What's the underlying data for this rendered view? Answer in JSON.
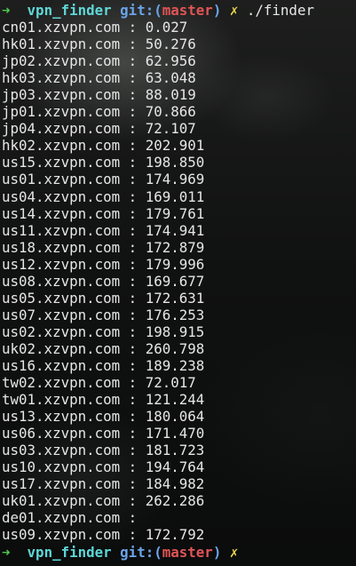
{
  "prompt": {
    "arrow": "➜",
    "cwd": "vpn_finder",
    "git_prefix": "git:(",
    "branch": "master",
    "git_suffix": ")",
    "dirty_mark": "✗"
  },
  "command": "./finder",
  "output": [
    {
      "host": "cn01.xzvpn.com",
      "latency": "0.027"
    },
    {
      "host": "hk01.xzvpn.com",
      "latency": "50.276"
    },
    {
      "host": "jp02.xzvpn.com",
      "latency": "62.956"
    },
    {
      "host": "hk03.xzvpn.com",
      "latency": "63.048"
    },
    {
      "host": "jp03.xzvpn.com",
      "latency": "88.019"
    },
    {
      "host": "jp01.xzvpn.com",
      "latency": "70.866"
    },
    {
      "host": "jp04.xzvpn.com",
      "latency": "72.107"
    },
    {
      "host": "hk02.xzvpn.com",
      "latency": "202.901"
    },
    {
      "host": "us15.xzvpn.com",
      "latency": "198.850"
    },
    {
      "host": "us01.xzvpn.com",
      "latency": "174.969"
    },
    {
      "host": "us04.xzvpn.com",
      "latency": "169.011"
    },
    {
      "host": "us14.xzvpn.com",
      "latency": "179.761"
    },
    {
      "host": "us11.xzvpn.com",
      "latency": "174.941"
    },
    {
      "host": "us18.xzvpn.com",
      "latency": "172.879"
    },
    {
      "host": "us12.xzvpn.com",
      "latency": "179.996"
    },
    {
      "host": "us08.xzvpn.com",
      "latency": "169.677"
    },
    {
      "host": "us05.xzvpn.com",
      "latency": "172.631"
    },
    {
      "host": "us07.xzvpn.com",
      "latency": "176.253"
    },
    {
      "host": "us02.xzvpn.com",
      "latency": "198.915"
    },
    {
      "host": "uk02.xzvpn.com",
      "latency": "260.798"
    },
    {
      "host": "us16.xzvpn.com",
      "latency": "189.238"
    },
    {
      "host": "tw02.xzvpn.com",
      "latency": "72.017"
    },
    {
      "host": "tw01.xzvpn.com",
      "latency": "121.244"
    },
    {
      "host": "us13.xzvpn.com",
      "latency": "180.064"
    },
    {
      "host": "us06.xzvpn.com",
      "latency": "171.470"
    },
    {
      "host": "us03.xzvpn.com",
      "latency": "181.723"
    },
    {
      "host": "us10.xzvpn.com",
      "latency": "194.764"
    },
    {
      "host": "us17.xzvpn.com",
      "latency": "184.982"
    },
    {
      "host": "uk01.xzvpn.com",
      "latency": "262.286"
    },
    {
      "host": "de01.xzvpn.com",
      "latency": ""
    },
    {
      "host": "us09.xzvpn.com",
      "latency": "172.792"
    }
  ],
  "separator": " : "
}
